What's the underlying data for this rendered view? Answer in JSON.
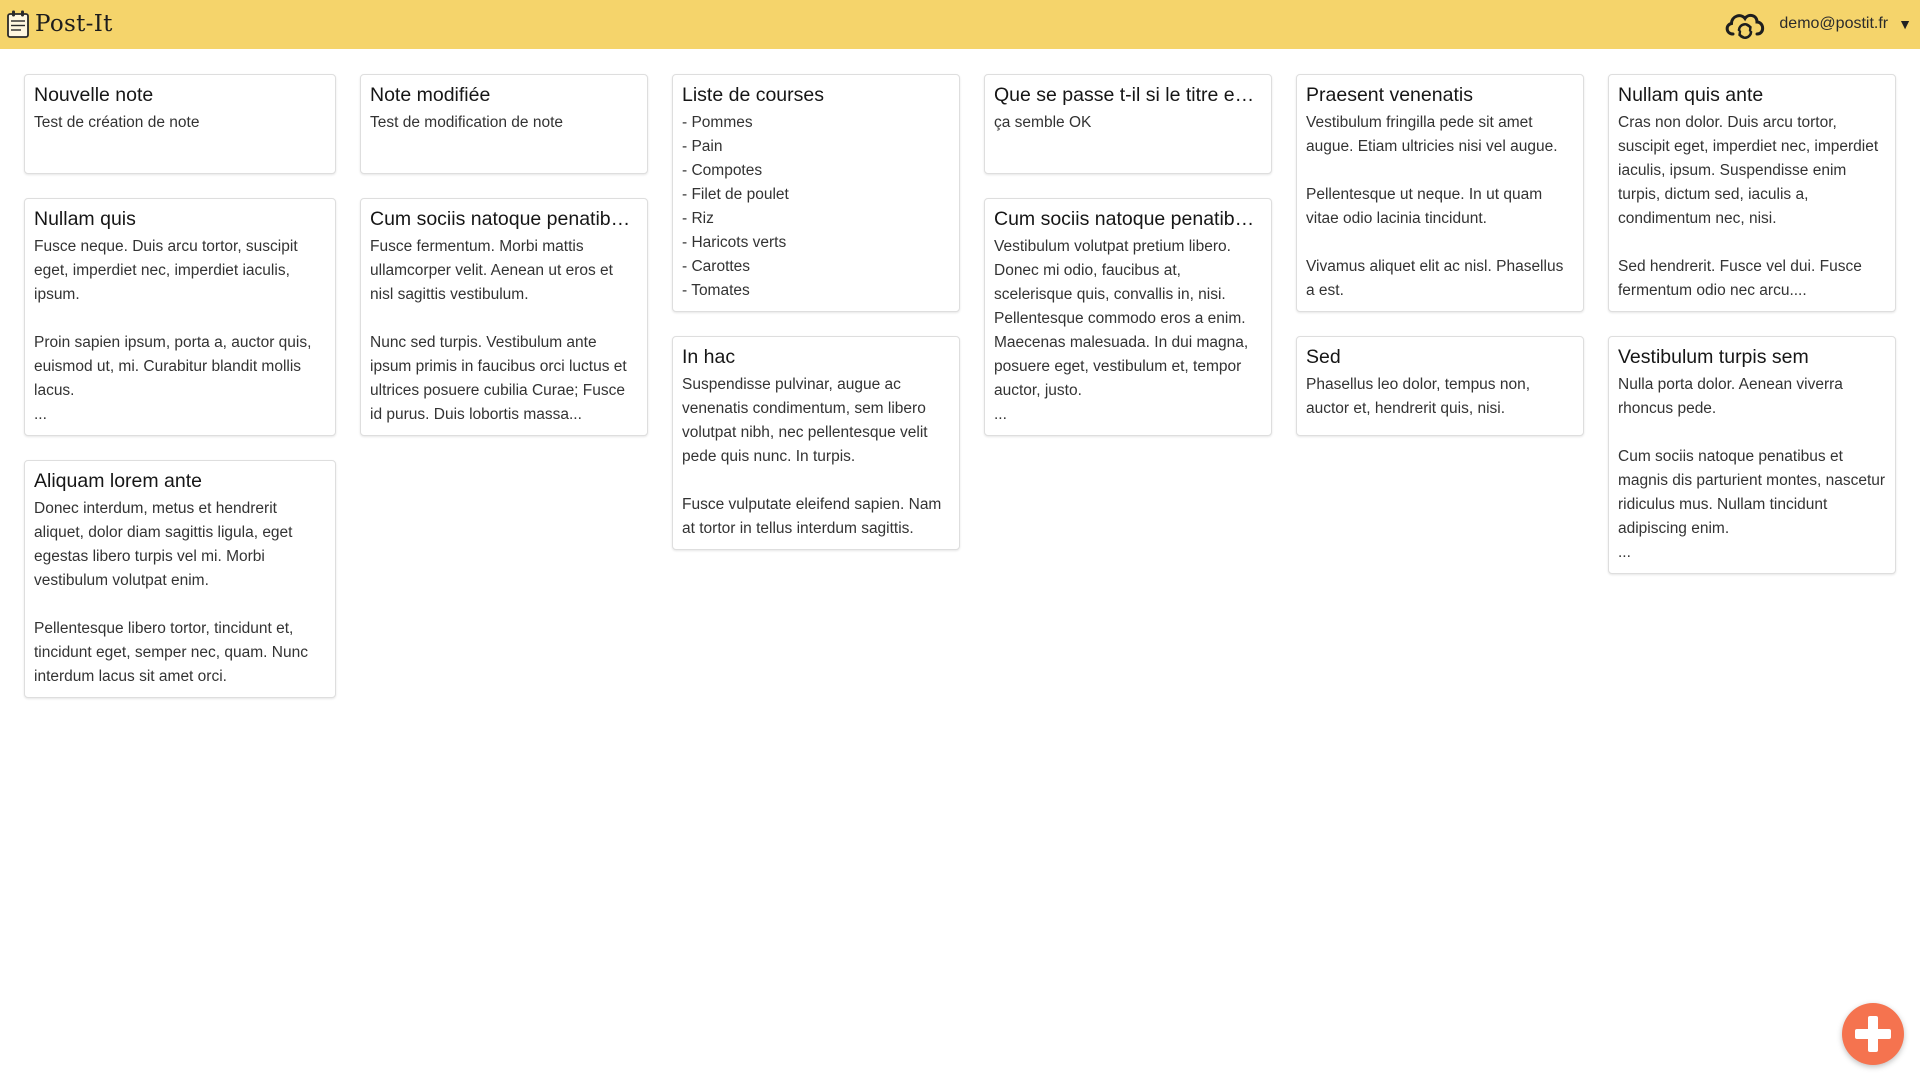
{
  "header": {
    "app_title": "Post-It",
    "logo_icon": "notepad-icon",
    "account_icon": "cloud-sync-icon",
    "user_email": "demo@postit.fr",
    "menu_caret": "▼",
    "background_color": "#f5d46b"
  },
  "notes": [
    {
      "title": "Nouvelle note",
      "body": "Test de création de note"
    },
    {
      "title": "Note modifiée",
      "body": "Test de modification de note"
    },
    {
      "title": "Liste de courses",
      "body": "- Pommes\n- Pain\n- Compotes\n- Filet de poulet\n- Riz\n- Haricots verts\n- Carottes\n- Tomates"
    },
    {
      "title": "Que se passe t-il si le titre est trop long ?",
      "body": "ça semble OK"
    },
    {
      "title": "Praesent venenatis",
      "body": "Vestibulum fringilla pede sit amet augue. Etiam ultricies nisi vel augue.\n\nPellentesque ut neque. In ut quam vitae odio lacinia tincidunt.\n\nVivamus aliquet elit ac nisl. Phasellus a est."
    },
    {
      "title": "Nullam quis ante",
      "body": "Cras non dolor. Duis arcu tortor, suscipit eget, imperdiet nec, imperdiet iaculis, ipsum. Suspendisse enim turpis, dictum sed, iaculis a, condimentum nec, nisi.\n\nSed hendrerit. Fusce vel dui. Fusce fermentum odio nec arcu...."
    },
    {
      "title": "Nullam quis",
      "body": "Fusce neque. Duis arcu tortor, suscipit eget, imperdiet nec, imperdiet iaculis, ipsum.\n\nProin sapien ipsum, porta a, auctor quis, euismod ut, mi. Curabitur blandit mollis lacus.\n..."
    },
    {
      "title": "Cum sociis natoque penatibus et magnis",
      "body": "Fusce fermentum. Morbi mattis ullamcorper velit. Aenean ut eros et nisl sagittis vestibulum.\n\nNunc sed turpis. Vestibulum ante ipsum primis in faucibus orci luctus et ultrices posuere cubilia Curae; Fusce id purus. Duis lobortis massa..."
    },
    {
      "title": "In hac",
      "body": "Suspendisse pulvinar, augue ac venenatis condimentum, sem libero volutpat nibh, nec pellentesque velit pede quis nunc. In turpis.\n\nFusce vulputate eleifend sapien. Nam at tortor in tellus interdum sagittis."
    },
    {
      "title": "Cum sociis natoque penatibus et magnis",
      "body": "Vestibulum volutpat pretium libero. Donec mi odio, faucibus at, scelerisque quis, convallis in, nisi. Pellentesque commodo eros a enim. Maecenas malesuada. In dui magna, posuere eget, vestibulum et, tempor auctor, justo.\n..."
    },
    {
      "title": "Sed",
      "body": "Phasellus leo dolor, tempus non, auctor et, hendrerit quis, nisi."
    },
    {
      "title": "Vestibulum turpis sem",
      "body": "Nulla porta dolor. Aenean viverra rhoncus pede.\n\nCum sociis natoque penatibus et magnis dis parturient montes, nascetur ridiculus mus. Nullam tincidunt adipiscing enim.\n..."
    },
    {
      "title": "Aliquam lorem ante",
      "body": "Donec interdum, metus et hendrerit aliquet, dolor diam sagittis ligula, eget egestas libero turpis vel mi. Morbi vestibulum volutpat enim.\n\nPellentesque libero tortor, tincidunt et, tincidunt eget, semper nec, quam. Nunc interdum lacus sit amet orci."
    }
  ],
  "add_button": {
    "icon": "plus-icon",
    "color": "#f5734f"
  }
}
